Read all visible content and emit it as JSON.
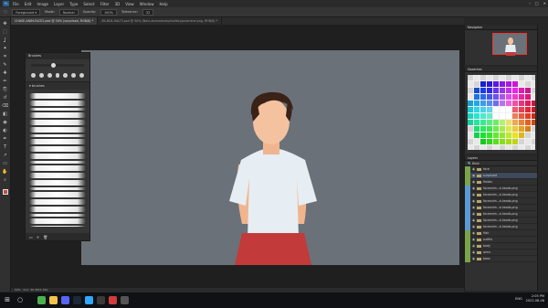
{
  "menubar": {
    "logo": "Ps",
    "items": [
      "File",
      "Edit",
      "Image",
      "Layer",
      "Type",
      "Select",
      "Filter",
      "3D",
      "View",
      "Window",
      "Help"
    ]
  },
  "options": {
    "mode_label": "Mode:",
    "mode_value": "Normal",
    "opacity_label": "Opacity:",
    "opacity_value": "100%",
    "tolerance_label": "Tolerance:",
    "tolerance_value": "32"
  },
  "tabs": [
    {
      "label": "CHASE-ANIM-FACE2.psd @ 50% (surprised, RGB/8) *"
    },
    {
      "label": "ZB-BOX-HALTS.psd @ 50% (Navi-atomo/moto/hallelu/pruemine.png, RGB/8) *"
    }
  ],
  "tools": [
    "move",
    "select",
    "lasso",
    "magic",
    "crop",
    "eyedrop",
    "heal",
    "brush",
    "stamp",
    "history",
    "eraser",
    "fill",
    "blur",
    "dodge",
    "pen",
    "type",
    "path",
    "shape",
    "hand",
    "zoom"
  ],
  "brushes_panel": {
    "title": "Brushes",
    "folder": "brushes",
    "stroke_count": 22
  },
  "navigator": {
    "title": "Navigator",
    "zoom": "50%"
  },
  "swatches": {
    "title": "Swatches"
  },
  "layers": {
    "title": "Layers",
    "kind": "Kind",
    "rows": [
      {
        "label": "face",
        "color": "#7aa34a",
        "sel": false
      },
      {
        "label": "surprised",
        "color": "#7aa34a",
        "sel": true
      },
      {
        "label": "Heads",
        "color": "#7aa34a",
        "sel": false
      },
      {
        "label": "faceanim...e-heads.png",
        "color": "#5b9ad5",
        "sel": false
      },
      {
        "label": "faceanim...e-heads.png",
        "color": "#5b9ad5",
        "sel": false
      },
      {
        "label": "faceanim...e-heads.png",
        "color": "#5b9ad5",
        "sel": false
      },
      {
        "label": "faceanim...e-heads.png",
        "color": "#5b9ad5",
        "sel": false
      },
      {
        "label": "faceanim...e-heads.png",
        "color": "#5b9ad5",
        "sel": false
      },
      {
        "label": "faceanim...e-heads.png",
        "color": "#5b9ad5",
        "sel": false
      },
      {
        "label": "faceanim...e-heads.png",
        "color": "#5b9ad5",
        "sel": false
      },
      {
        "label": "Hair",
        "color": "#7aa34a",
        "sel": false
      },
      {
        "label": "outfits",
        "color": "#7aa34a",
        "sel": false
      },
      {
        "label": "body",
        "color": "#7aa34a",
        "sel": false
      },
      {
        "label": "arms",
        "color": "#7aa34a",
        "sel": false
      },
      {
        "label": "base",
        "color": "#7aa34a",
        "sel": false
      }
    ]
  },
  "status": {
    "zoom": "50%",
    "doc": "Doc: 46.4M/1.34G"
  },
  "taskbar": {
    "clock_time": "2:05 PM",
    "clock_date": "2022-08-08",
    "lang": "ENG",
    "icons": [
      {
        "name": "chrome",
        "color": "#4caf50"
      },
      {
        "name": "explorer",
        "color": "#f2c14e"
      },
      {
        "name": "discord",
        "color": "#5865f2"
      },
      {
        "name": "steam",
        "color": "#1b2838"
      },
      {
        "name": "photoshop",
        "color": "#31a8ff"
      },
      {
        "name": "app",
        "color": "#3a3a3a"
      },
      {
        "name": "red-app",
        "color": "#d23c3c"
      },
      {
        "name": "app2",
        "color": "#555"
      }
    ]
  }
}
